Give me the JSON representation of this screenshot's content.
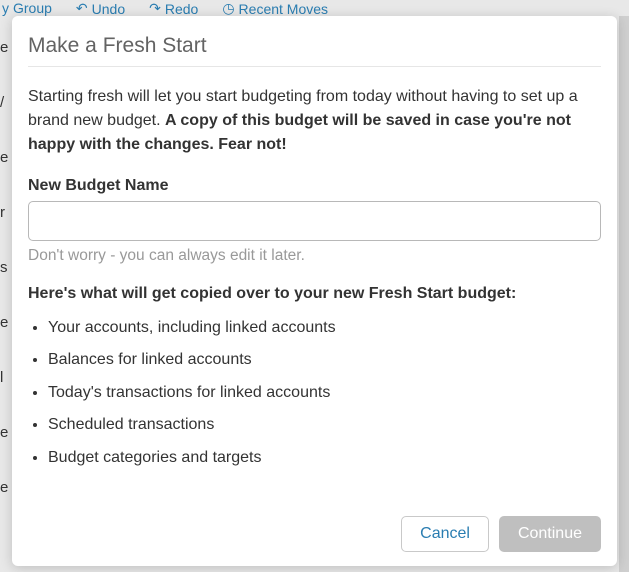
{
  "bg": {
    "toolbar": {
      "group": "Group",
      "undo": "Undo",
      "redo": "Redo",
      "recent": "Recent Moves"
    },
    "left": [
      "e",
      "/",
      "e",
      "r",
      "s",
      "e",
      "l",
      "e",
      "e"
    ]
  },
  "modal": {
    "title": "Make a Fresh Start",
    "desc_plain": "Starting fresh will let you start budgeting from today without having to set up a brand new budget. ",
    "desc_bold": "A copy of this budget will be saved in case you're not happy with the changes. Fear not!",
    "field_label": "New Budget Name",
    "input_value": "",
    "help_text": "Don't worry - you can always edit it later.",
    "copy_heading": "Here's what will get copied over to your new Fresh Start budget:",
    "copy_items": [
      "Your accounts, including linked accounts",
      "Balances for linked accounts",
      "Today's transactions for linked accounts",
      "Scheduled transactions",
      "Budget categories and targets"
    ],
    "cancel": "Cancel",
    "continue": "Continue"
  }
}
